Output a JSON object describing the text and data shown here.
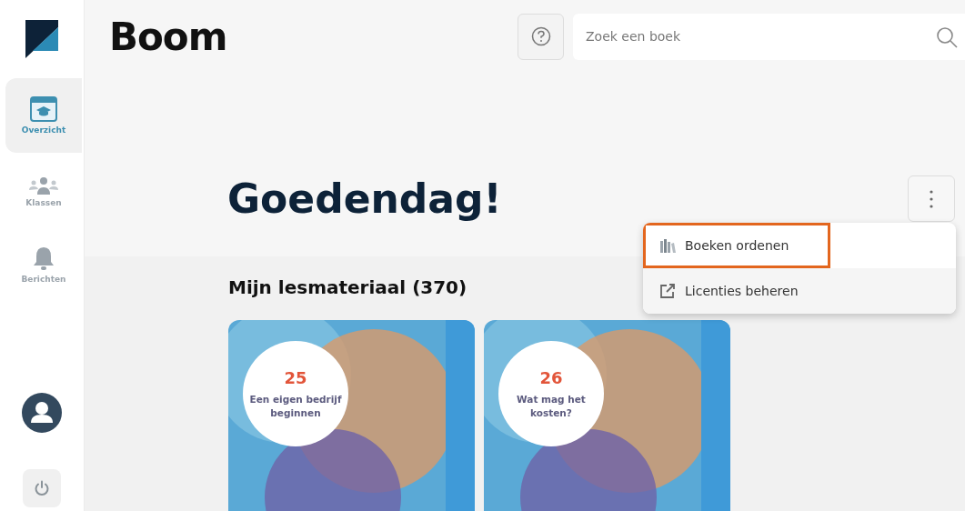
{
  "sidebar": {
    "items": [
      {
        "label": "Overzicht",
        "selected": true
      },
      {
        "label": "Klassen",
        "selected": false
      },
      {
        "label": "Berichten",
        "selected": false
      }
    ]
  },
  "header": {
    "brand": "Boom",
    "search": {
      "placeholder": "Zoek een boek"
    }
  },
  "greeting": "Goedendag!",
  "menu": {
    "items": [
      {
        "label": "Boeken ordenen",
        "highlighted": true
      },
      {
        "label": "Licenties beheren",
        "highlighted": false
      }
    ]
  },
  "section_title": "Mijn lesmateriaal (370)",
  "books": [
    {
      "number": "25",
      "title": "Een eigen bedrijf beginnen"
    },
    {
      "number": "26",
      "title": "Wat mag het kosten?"
    }
  ]
}
